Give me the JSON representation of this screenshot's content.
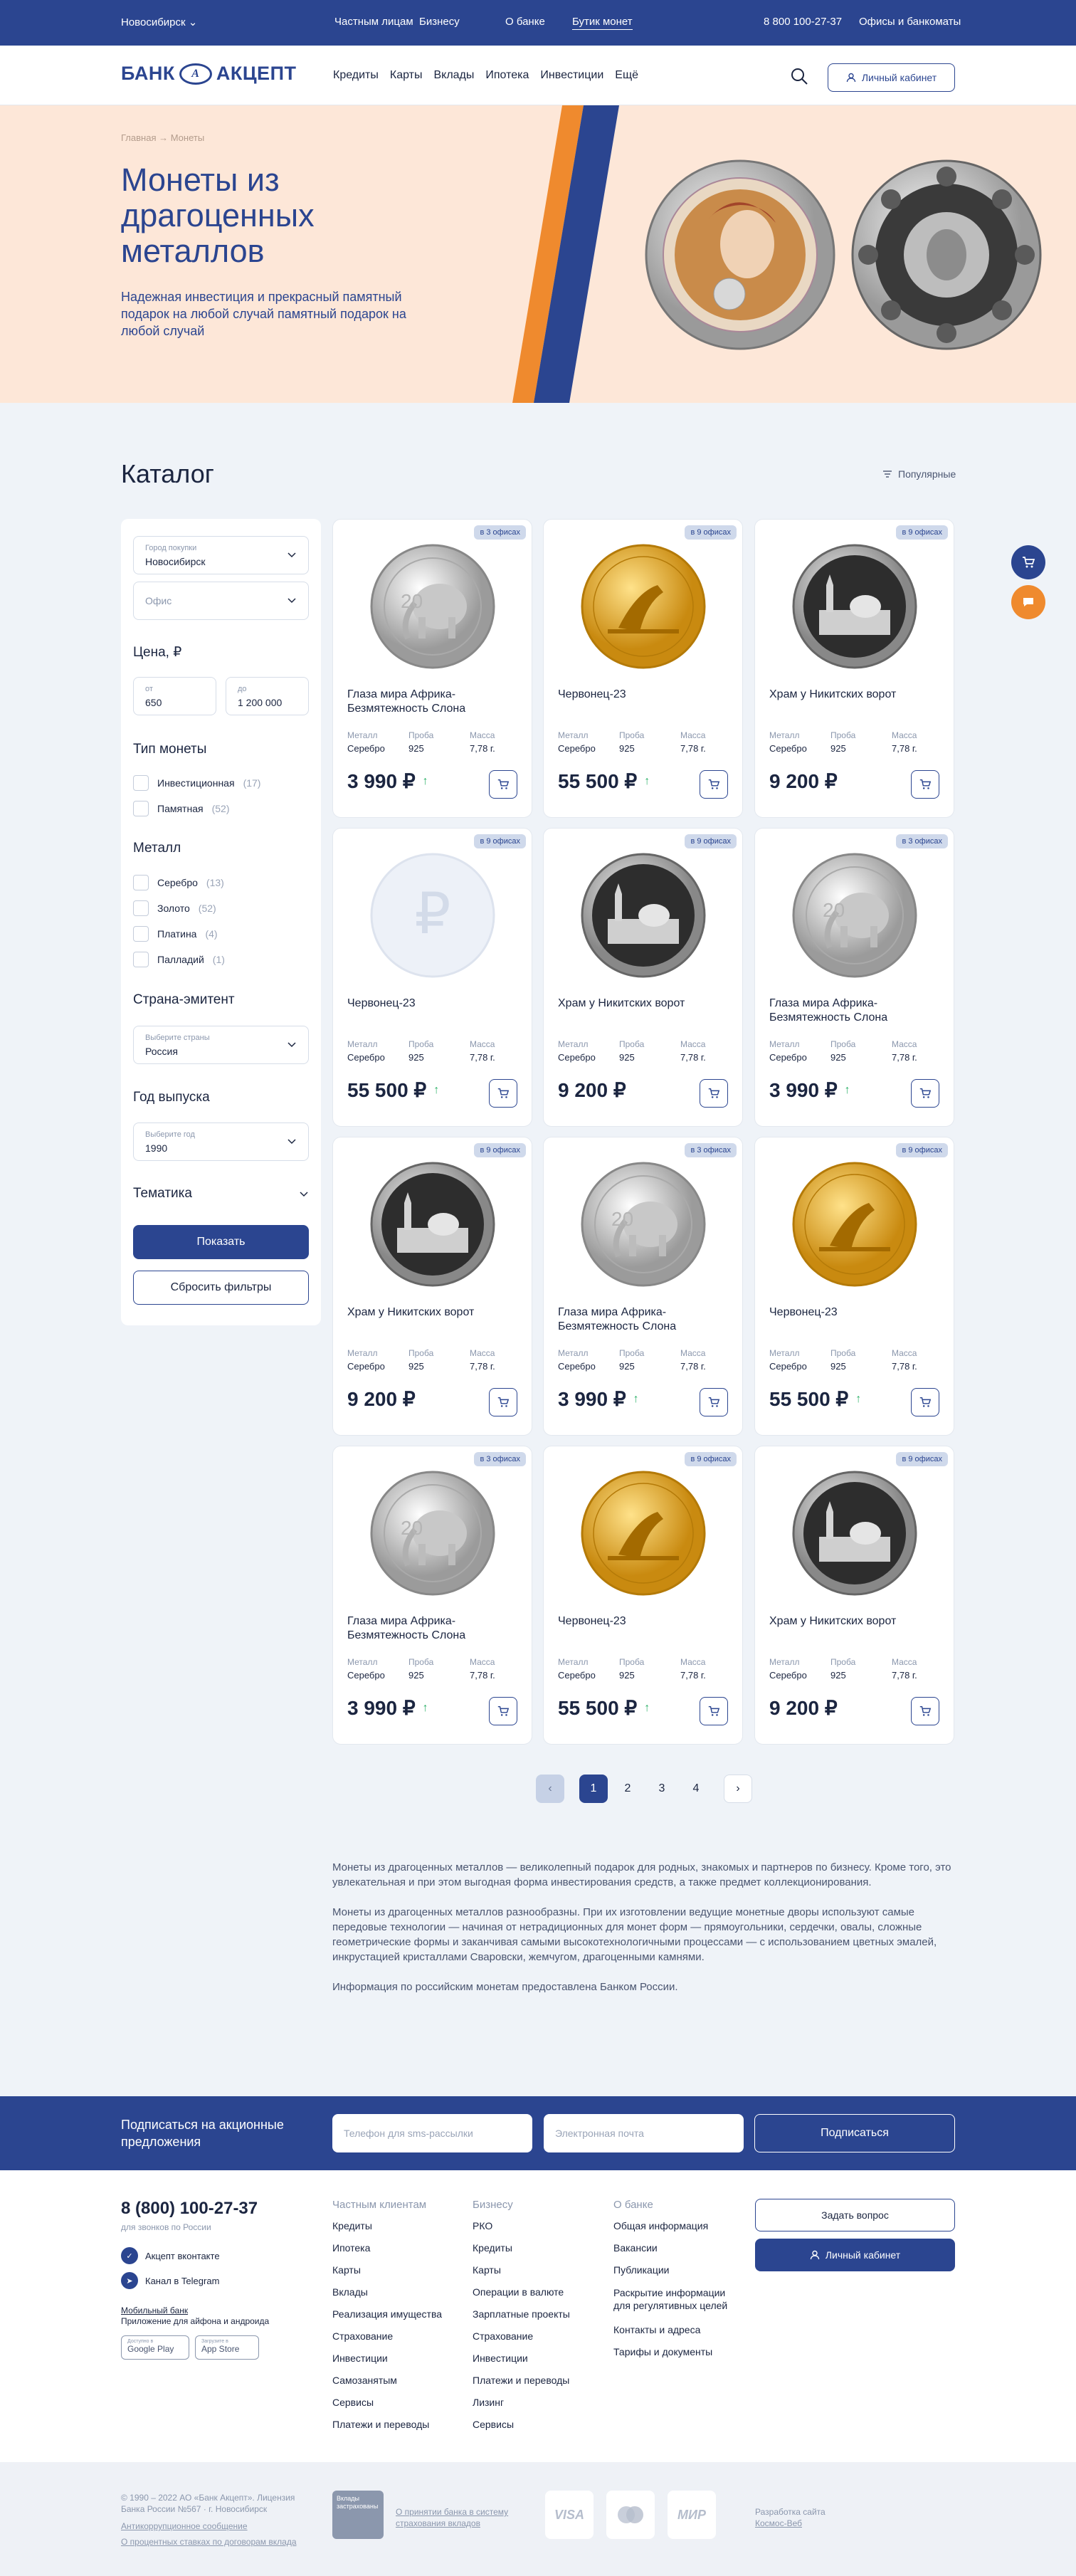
{
  "topbar": {
    "city": "Новосибирск",
    "links": [
      "Частным лицам",
      "Бизнесу",
      "О банке",
      "Бутик монет"
    ],
    "phone": "8 800 100-27-37",
    "offices": "Офисы и банкоматы"
  },
  "header": {
    "logo_left": "БАНК",
    "logo_mark": "А",
    "logo_right": "АКЦЕПТ",
    "nav": [
      "Кредиты",
      "Карты",
      "Вклады",
      "Ипотека",
      "Инвестиции",
      "Ещё"
    ],
    "cabinet": "Личный кабинет"
  },
  "hero": {
    "breadcrumb": "Главная  →  Монеты",
    "title": "Монеты из драгоценных металлов",
    "subtitle": "Надежная инвестиция и прекрасный памятный подарок на любой случай памятный подарок на любой случай"
  },
  "catalog": {
    "title": "Каталог",
    "sort": "Популярные"
  },
  "filters": {
    "city_label": "Город покупки",
    "city_value": "Новосибирск",
    "office_placeholder": "Офис",
    "price_title": "Цена, ₽",
    "price_from_label": "от",
    "price_from": "650",
    "price_to_label": "до",
    "price_to": "1 200 000",
    "type_title": "Тип монеты",
    "types": [
      {
        "label": "Инвестиционная",
        "count": "(17)"
      },
      {
        "label": "Памятная",
        "count": "(52)"
      }
    ],
    "metal_title": "Металл",
    "metals": [
      {
        "label": "Серебро",
        "count": "(13)"
      },
      {
        "label": "Золото",
        "count": "(52)"
      },
      {
        "label": "Платина",
        "count": "(4)"
      },
      {
        "label": "Палладий",
        "count": "(1)"
      }
    ],
    "country_title": "Страна-эмитент",
    "country_label": "Выберите страны",
    "country_value": "Россия",
    "year_title": "Год выпуска",
    "year_label": "Выберите год",
    "year_value": "1990",
    "theme_title": "Тематика",
    "show": "Показать",
    "reset": "Сбросить фильтры"
  },
  "spec_labels": {
    "metal": "Металл",
    "probe": "Проба",
    "mass": "Масса"
  },
  "products": [
    {
      "badge": "в 3 офисах",
      "title": "Глаза мира Африка-Безмятежность Слона",
      "metal": "Серебро",
      "probe": "925",
      "mass": "7,78 г.",
      "price": "3 990 ₽",
      "trend": "↑",
      "coin": "elephant"
    },
    {
      "badge": "в 9 офисах",
      "title": "Червонец-23",
      "metal": "Серебро",
      "probe": "925",
      "mass": "7,78 г.",
      "price": "55 500 ₽",
      "trend": "↑",
      "coin": "gold"
    },
    {
      "badge": "в 9 офисах",
      "title": "Храм у Никитских ворот",
      "metal": "Серебро",
      "probe": "925",
      "mass": "7,78 г.",
      "price": "9 200 ₽",
      "trend": "",
      "coin": "temple"
    },
    {
      "badge": "в 9 офисах",
      "title": "Червонец-23",
      "metal": "Серебро",
      "probe": "925",
      "mass": "7,78 г.",
      "price": "55 500 ₽",
      "trend": "↑",
      "coin": "placeholder"
    },
    {
      "badge": "в 9 офисах",
      "title": "Храм у Никитских ворот",
      "metal": "Серебро",
      "probe": "925",
      "mass": "7,78 г.",
      "price": "9 200 ₽",
      "trend": "",
      "coin": "temple"
    },
    {
      "badge": "в 3 офисах",
      "title": "Глаза мира Африка-Безмятежность Слона",
      "metal": "Серебро",
      "probe": "925",
      "mass": "7,78 г.",
      "price": "3 990 ₽",
      "trend": "↑",
      "coin": "elephant"
    },
    {
      "badge": "в 9 офисах",
      "title": "Храм у Никитских ворот",
      "metal": "Серебро",
      "probe": "925",
      "mass": "7,78 г.",
      "price": "9 200 ₽",
      "trend": "",
      "coin": "temple"
    },
    {
      "badge": "в 3 офисах",
      "title": "Глаза мира Африка-Безмятежность Слона",
      "metal": "Серебро",
      "probe": "925",
      "mass": "7,78 г.",
      "price": "3 990 ₽",
      "trend": "↑",
      "coin": "elephant"
    },
    {
      "badge": "в 9 офисах",
      "title": "Червонец-23",
      "metal": "Серебро",
      "probe": "925",
      "mass": "7,78 г.",
      "price": "55 500 ₽",
      "trend": "↑",
      "coin": "gold"
    },
    {
      "badge": "в 3 офисах",
      "title": "Глаза мира Африка-Безмятежность Слона",
      "metal": "Серебро",
      "probe": "925",
      "mass": "7,78 г.",
      "price": "3 990 ₽",
      "trend": "↑",
      "coin": "elephant"
    },
    {
      "badge": "в 9 офисах",
      "title": "Червонец-23",
      "metal": "Серебро",
      "probe": "925",
      "mass": "7,78 г.",
      "price": "55 500 ₽",
      "trend": "↑",
      "coin": "gold"
    },
    {
      "badge": "в 9 офисах",
      "title": "Храм у Никитских ворот",
      "metal": "Серебро",
      "probe": "925",
      "mass": "7,78 г.",
      "price": "9 200 ₽",
      "trend": "",
      "coin": "temple"
    }
  ],
  "pagination": {
    "prev": "‹",
    "pages": [
      "1",
      "2",
      "3",
      "4"
    ],
    "current": "1",
    "next": "›"
  },
  "seo": [
    "Монеты из драгоценных металлов — великолепный подарок для родных, знакомых и партнеров по бизнесу. Кроме того, это увлекательная и при этом выгодная форма инвестирования средств, а также предмет коллекционирования.",
    "Монеты из драгоценных металлов разнообразны. При их изготовлении ведущие монетные дворы используют самые передовые технологии — начиная от нетрадиционных для монет форм — прямоугольники, сердечки, овалы, сложные геометрические формы и заканчивая самыми высокотехнологичными процессами — с использованием цветных эмалей, инкрустацией кристаллами Сваровски, жемчугом, драгоценными камнями.",
    "Информация по российским монетам предоставлена Банком России."
  ],
  "subscribe": {
    "title": "Подписаться на акционные предложения",
    "phone_placeholder": "Телефон для sms-рассылки",
    "email_placeholder": "Электронная почта",
    "button": "Подписаться"
  },
  "footer": {
    "phone": "8 (800) 100-27-37",
    "phone_note": "для звонков по России",
    "vk": "Акцепт вконтакте",
    "telegram": "Канал в Telegram",
    "app_title": "Мобильный банк",
    "app_sub": "Приложение для айфона и андроида",
    "google_small": "Доступно в",
    "google": "Google Play",
    "apple_small": "Загрузите в",
    "apple": "App Store",
    "col1_title": "Частным клиентам",
    "col1": [
      "Кредиты",
      "Ипотека",
      "Карты",
      "Вклады",
      "Реализация имущества",
      "Страхование",
      "Инвестиции",
      "Самозанятым",
      "Сервисы",
      "Платежи и переводы"
    ],
    "col2_title": "Бизнесу",
    "col2": [
      "РКО",
      "Кредиты",
      "Карты",
      "Операции в валюте",
      "Зарплатные проекты",
      "Страхование",
      "Инвестиции",
      "Платежи и переводы",
      "Лизинг",
      "Сервисы"
    ],
    "col3_title": "О банке",
    "col3": [
      "Общая информация",
      "Вакансии",
      "Публикации",
      "Раскрытие информации для регулятивных целей",
      "Контакты и адреса",
      "Тарифы и документы"
    ],
    "ask": "Задать вопрос",
    "cabinet": "Личный кабинет"
  },
  "bottom": {
    "copyright": "© 1990 – 2022 АО «Банк Акцепт». Лицензия Банка России №567 · г. Новосибирск",
    "anticorruption": "Антикоррупционное сообщение",
    "rates": "О процентных ставках по договорам вклада",
    "deposit_badge": "Вклады застрахованы",
    "deposit_link": "О принятии банка в систему страхования вкладов",
    "visa": "VISA",
    "mir": "МИР",
    "dev_label": "Разработка сайта",
    "dev": "Космос-Веб"
  },
  "colors": {
    "brand": "#2b4590",
    "accent": "#ef8a2e",
    "hero_bg": "#fde7d8",
    "positive": "#2fb26a"
  }
}
